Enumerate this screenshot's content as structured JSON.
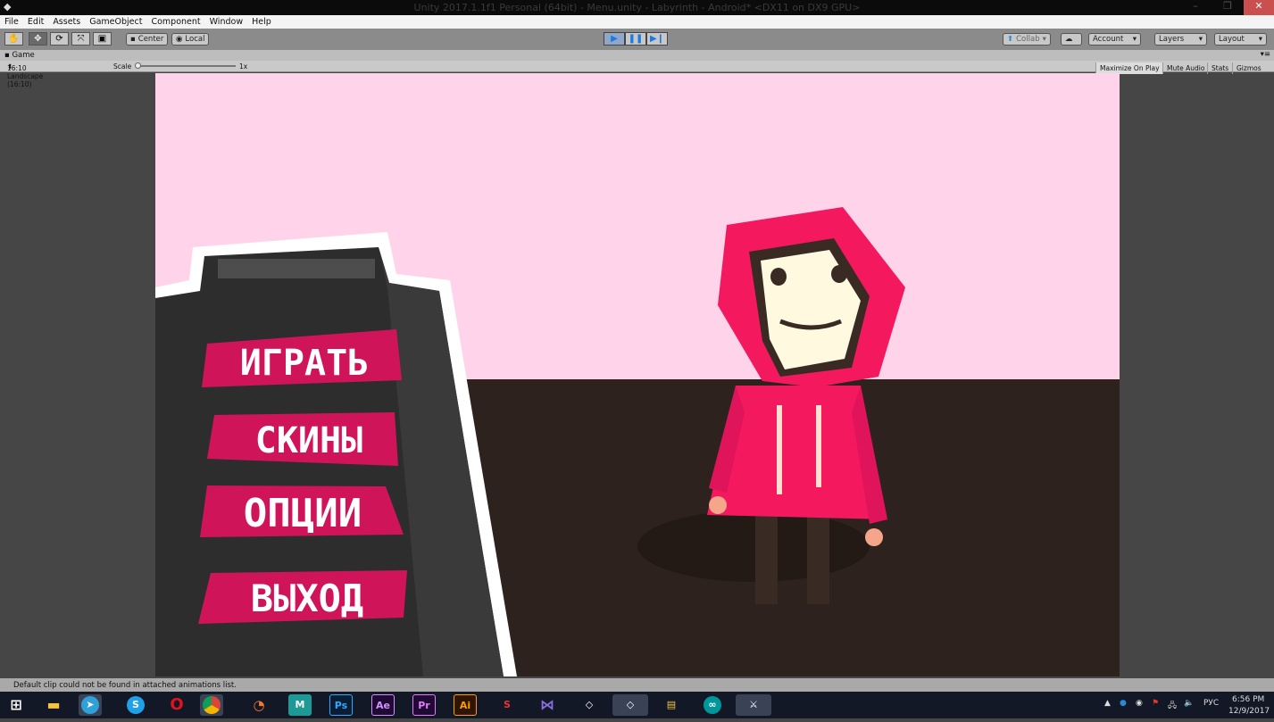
{
  "window": {
    "title": "Unity 2017.1.1f1 Personal (64bit) - Menu.unity - Labyrinth - Android* <DX11 on DX9 GPU>"
  },
  "menu": [
    "File",
    "Edit",
    "Assets",
    "GameObject",
    "Component",
    "Window",
    "Help"
  ],
  "toolbar": {
    "pivot": "Center",
    "space": "Local",
    "collab": "Collab",
    "account": "Account",
    "layers": "Layers",
    "layout": "Layout"
  },
  "game": {
    "tab": "Game",
    "aspect": "16:10 Landscape (16:10)",
    "scale_label": "Scale",
    "scale_value": "1x",
    "buttons": [
      "Maximize On Play",
      "Mute Audio",
      "Stats",
      "Gizmos"
    ]
  },
  "game_menu": {
    "buttons": [
      "ИГРАТЬ",
      "СКИНЫ",
      "ОПЦИИ",
      "ВЫХОД"
    ],
    "colors": {
      "sky": "#ffd3ea",
      "floor": "#2e221e",
      "button": "#d0145a",
      "hood": "#f4185e"
    }
  },
  "status": {
    "message": "Default clip could not be found in attached animations list."
  },
  "taskbar": {
    "icons": [
      "windows-start",
      "file-explorer",
      "telegram",
      "skype",
      "opera",
      "chrome",
      "blender",
      "maya",
      "photoshop",
      "after-effects",
      "premiere",
      "illustrator",
      "app",
      "visual-studio",
      "unity",
      "unity",
      "paint",
      "arduino",
      "app"
    ],
    "labels": {
      "photoshop": "Ps",
      "after-effects": "Ae",
      "premiere": "Pr",
      "illustrator": "Ai"
    },
    "language": "РУС",
    "time": "6:56 PM",
    "date": "12/9/2017"
  }
}
